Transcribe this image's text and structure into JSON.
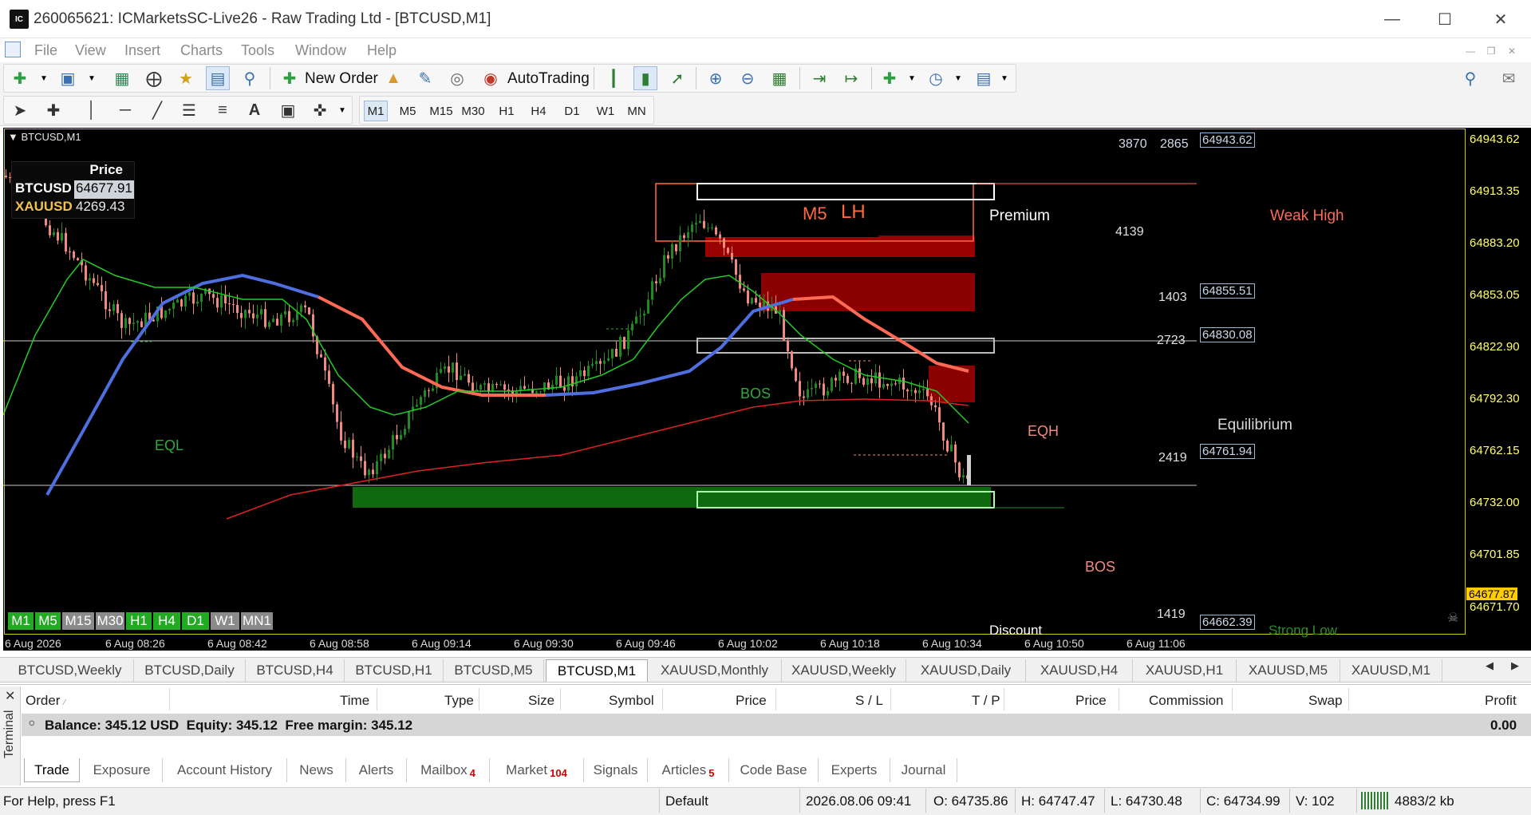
{
  "window": {
    "title": "260065621: ICMarketsSC-Live26 - Raw Trading Ltd - [BTCUSD,M1]",
    "logo_text": "IC"
  },
  "menu": [
    "File",
    "View",
    "Insert",
    "Charts",
    "Tools",
    "Window",
    "Help"
  ],
  "toolbar": {
    "new_order": "New Order",
    "autotrading": "AutoTrading"
  },
  "timeframes": [
    "M1",
    "M5",
    "M15",
    "M30",
    "H1",
    "H4",
    "D1",
    "W1",
    "MN"
  ],
  "chart": {
    "symbol_label": "BTCUSD,M1",
    "price_panel": {
      "header": "Price",
      "rows": [
        {
          "symbol": "BTCUSD",
          "price": "64677.91"
        },
        {
          "symbol": "XAUUSD",
          "price": "4269.43"
        }
      ]
    },
    "y_axis": [
      "64943.62",
      "64913.35",
      "64883.20",
      "64853.05",
      "64822.90",
      "64792.30",
      "64762.15",
      "64732.00",
      "64701.85",
      "64671.70"
    ],
    "current_price": "64677.87",
    "x_axis": [
      "6 Aug 2026",
      "6 Aug 08:26",
      "6 Aug 08:42",
      "6 Aug 08:58",
      "6 Aug 09:14",
      "6 Aug 09:30",
      "6 Aug 09:46",
      "6 Aug 10:02",
      "6 Aug 10:18",
      "6 Aug 10:34",
      "6 Aug 10:50",
      "6 Aug 11:06"
    ],
    "top_counts": [
      "3870",
      "2865"
    ],
    "price_tags": [
      "64943.62",
      "64855.51",
      "64830.08",
      "64761.94",
      "64662.39"
    ],
    "zone_values": [
      "4139",
      "1403",
      "2723",
      "2419",
      "1419"
    ],
    "labels": {
      "m5": "M5",
      "lh": "LH",
      "premium": "Premium",
      "weak_high": "Weak High",
      "equilibrium": "Equilibrium",
      "discount": "Discount",
      "strong_low": "Strong Low",
      "eql": "EQL",
      "eqh": "EQH",
      "bos_green": "BOS",
      "bos_red": "BOS"
    },
    "tf_badges": [
      "M1",
      "M5",
      "M15",
      "M30",
      "H1",
      "H4",
      "D1",
      "W1",
      "MN1"
    ]
  },
  "symbol_tabs": [
    "BTCUSD,Weekly",
    "BTCUSD,Daily",
    "BTCUSD,H4",
    "BTCUSD,H1",
    "BTCUSD,M5",
    "BTCUSD,M1",
    "XAUUSD,Monthly",
    "XAUUSD,Weekly",
    "XAUUSD,Daily",
    "XAUUSD,H4",
    "XAUUSD,H1",
    "XAUUSD,M5",
    "XAUUSD,M1"
  ],
  "terminal": {
    "side_label": "Terminal",
    "columns": [
      "Order",
      "Time",
      "Type",
      "Size",
      "Symbol",
      "Price",
      "S / L",
      "T / P",
      "Price",
      "Commission",
      "Swap",
      "Profit"
    ],
    "balance_text": "Balance: 345.12 USD  Equity: 345.12  Free margin: 345.12",
    "balance_profit": "0.00",
    "tabs": [
      {
        "label": "Trade",
        "badge": ""
      },
      {
        "label": "Exposure",
        "badge": ""
      },
      {
        "label": "Account History",
        "badge": ""
      },
      {
        "label": "News",
        "badge": ""
      },
      {
        "label": "Alerts",
        "badge": ""
      },
      {
        "label": "Mailbox",
        "badge": "4"
      },
      {
        "label": "Market",
        "badge": "104"
      },
      {
        "label": "Signals",
        "badge": ""
      },
      {
        "label": "Articles",
        "badge": "5"
      },
      {
        "label": "Code Base",
        "badge": ""
      },
      {
        "label": "Experts",
        "badge": ""
      },
      {
        "label": "Journal",
        "badge": ""
      }
    ]
  },
  "statusbar": {
    "help": "For Help, press F1",
    "profile": "Default",
    "datetime": "2026.08.06 09:41",
    "open": "O: 64735.86",
    "high": "H: 64747.47",
    "low": "L: 64730.48",
    "close": "C: 64734.99",
    "volume": "V: 102",
    "traffic": "4883/2 kb"
  },
  "colors": {
    "bull": "#1f8a1f",
    "bear": "#f08a80",
    "blue_ma": "#4f6fe0",
    "red_ma": "#ff6a55",
    "green_ma": "#22cc22",
    "ema200": "#dd2222",
    "axis_text": "#ffff66"
  }
}
